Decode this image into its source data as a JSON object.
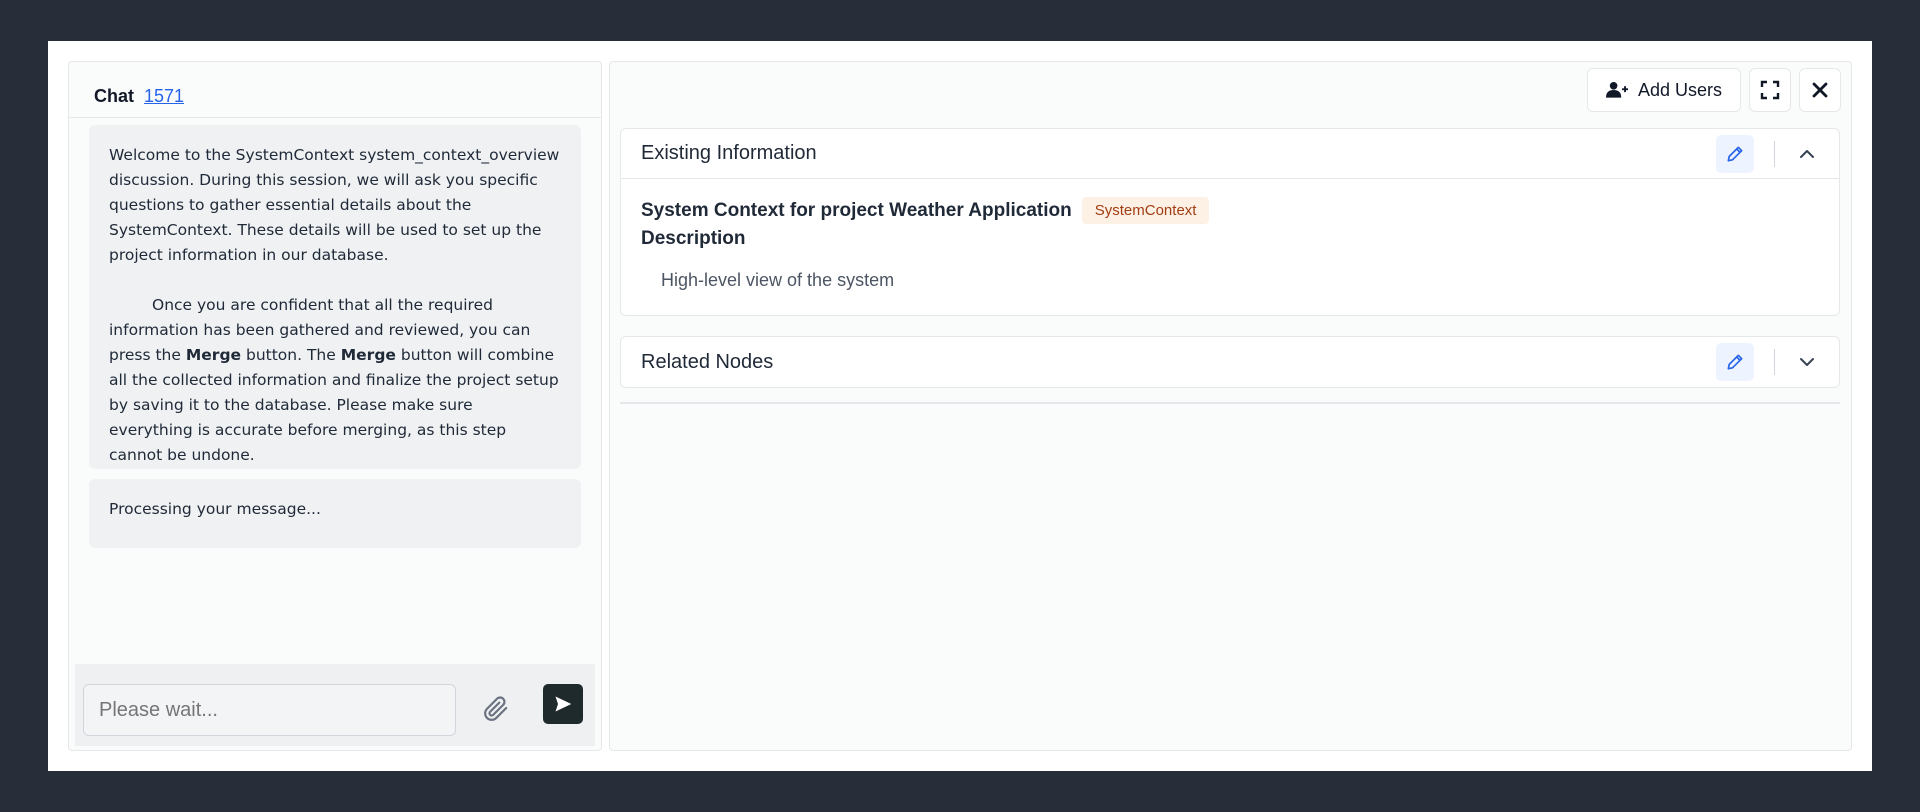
{
  "chat": {
    "title": "Chat",
    "id_link": "1571",
    "messages": {
      "welcome_p1": "Welcome to the SystemContext system_context_overview discussion. During this session, we will ask you specific questions to gather essential details about the SystemContext. These details will be used to set up the project information in our database.",
      "welcome_p2_a": "Once you are confident that all the required information has been gathered and reviewed, you can press the ",
      "welcome_p2_merge1": "Merge",
      "welcome_p2_b": " button. The ",
      "welcome_p2_merge2": "Merge",
      "welcome_p2_c": " button will combine all the collected information and finalize the project setup by saving it to the database. Please make sure everything is accurate before merging, as this step cannot be undone.",
      "processing": "Processing your message..."
    },
    "input": {
      "placeholder": "Please wait..."
    },
    "icons": {
      "attach": "paperclip-icon",
      "send": "send-icon"
    }
  },
  "toolbar": {
    "add_users_label": "Add Users",
    "icons": {
      "add_users": "user-plus-icon",
      "fullscreen": "expand-icon",
      "close": "close-icon"
    }
  },
  "existing_info": {
    "title": "Existing Information",
    "context_title": "System Context for project Weather Application",
    "tag": "SystemContext",
    "description_label": "Description",
    "description_value": "High-level view of the system",
    "icons": {
      "edit": "pencil-icon",
      "toggle": "chevron-up-icon"
    }
  },
  "related_nodes": {
    "title": "Related Nodes",
    "icons": {
      "edit": "pencil-icon",
      "toggle": "chevron-down-icon"
    }
  },
  "colors": {
    "backdrop": "#272e39",
    "link": "#2563eb",
    "tag_bg": "#fdf1e6",
    "tag_text": "#a23d12",
    "send_button": "#1f2a2c"
  }
}
